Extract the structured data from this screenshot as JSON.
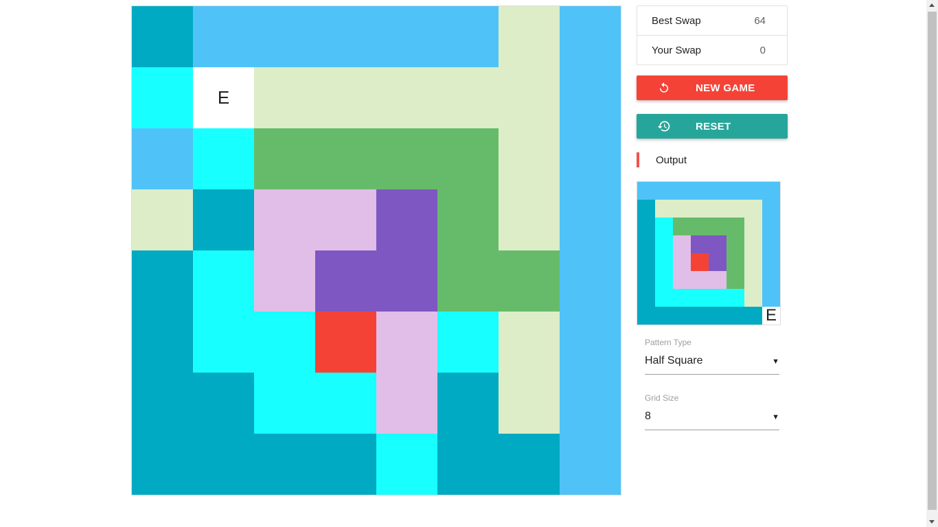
{
  "colors": {
    "B": "#4fc3f7",
    "T": "#00aac2",
    "C": "#18ffff",
    "L": "#dcedc8",
    "G": "#66bb6a",
    "P": "#e1bee7",
    "V": "#7e57c2",
    "R": "#f44336",
    "W": "#ffffff"
  },
  "board": {
    "empty_label": "E",
    "rows": [
      [
        "T",
        "B",
        "B",
        "B",
        "B",
        "B",
        "L",
        "B"
      ],
      [
        "C",
        "W",
        "L",
        "L",
        "L",
        "L",
        "L",
        "B"
      ],
      [
        "B",
        "C",
        "G",
        "G",
        "G",
        "G",
        "L",
        "B"
      ],
      [
        "L",
        "T",
        "P",
        "P",
        "V",
        "G",
        "L",
        "B"
      ],
      [
        "T",
        "C",
        "P",
        "V",
        "V",
        "G",
        "G",
        "B"
      ],
      [
        "T",
        "C",
        "C",
        "R",
        "P",
        "C",
        "L",
        "B"
      ],
      [
        "T",
        "T",
        "C",
        "C",
        "P",
        "T",
        "L",
        "B"
      ],
      [
        "T",
        "T",
        "T",
        "T",
        "C",
        "T",
        "T",
        "B"
      ]
    ]
  },
  "score": {
    "best_label": "Best Swap",
    "best_value": "64",
    "your_label": "Your Swap",
    "your_value": "0"
  },
  "buttons": {
    "new_game": "NEW GAME",
    "reset": "RESET",
    "new_game_icon": "refresh-icon",
    "reset_icon": "history-icon"
  },
  "output": {
    "label": "Output",
    "empty_label": "E",
    "rows": [
      [
        "B",
        "B",
        "B",
        "B",
        "B",
        "B",
        "B",
        "B"
      ],
      [
        "T",
        "L",
        "L",
        "L",
        "L",
        "L",
        "L",
        "B"
      ],
      [
        "T",
        "C",
        "G",
        "G",
        "G",
        "G",
        "L",
        "B"
      ],
      [
        "T",
        "C",
        "P",
        "V",
        "V",
        "G",
        "L",
        "B"
      ],
      [
        "T",
        "C",
        "P",
        "R",
        "V",
        "G",
        "L",
        "B"
      ],
      [
        "T",
        "C",
        "P",
        "P",
        "P",
        "G",
        "L",
        "B"
      ],
      [
        "T",
        "C",
        "C",
        "C",
        "C",
        "C",
        "L",
        "B"
      ],
      [
        "T",
        "T",
        "T",
        "T",
        "T",
        "T",
        "T",
        "W"
      ]
    ]
  },
  "pattern_type": {
    "label": "Pattern Type",
    "value": "Half Square"
  },
  "grid_size": {
    "label": "Grid Size",
    "value": "8"
  },
  "dropdown_arrow": "▼"
}
